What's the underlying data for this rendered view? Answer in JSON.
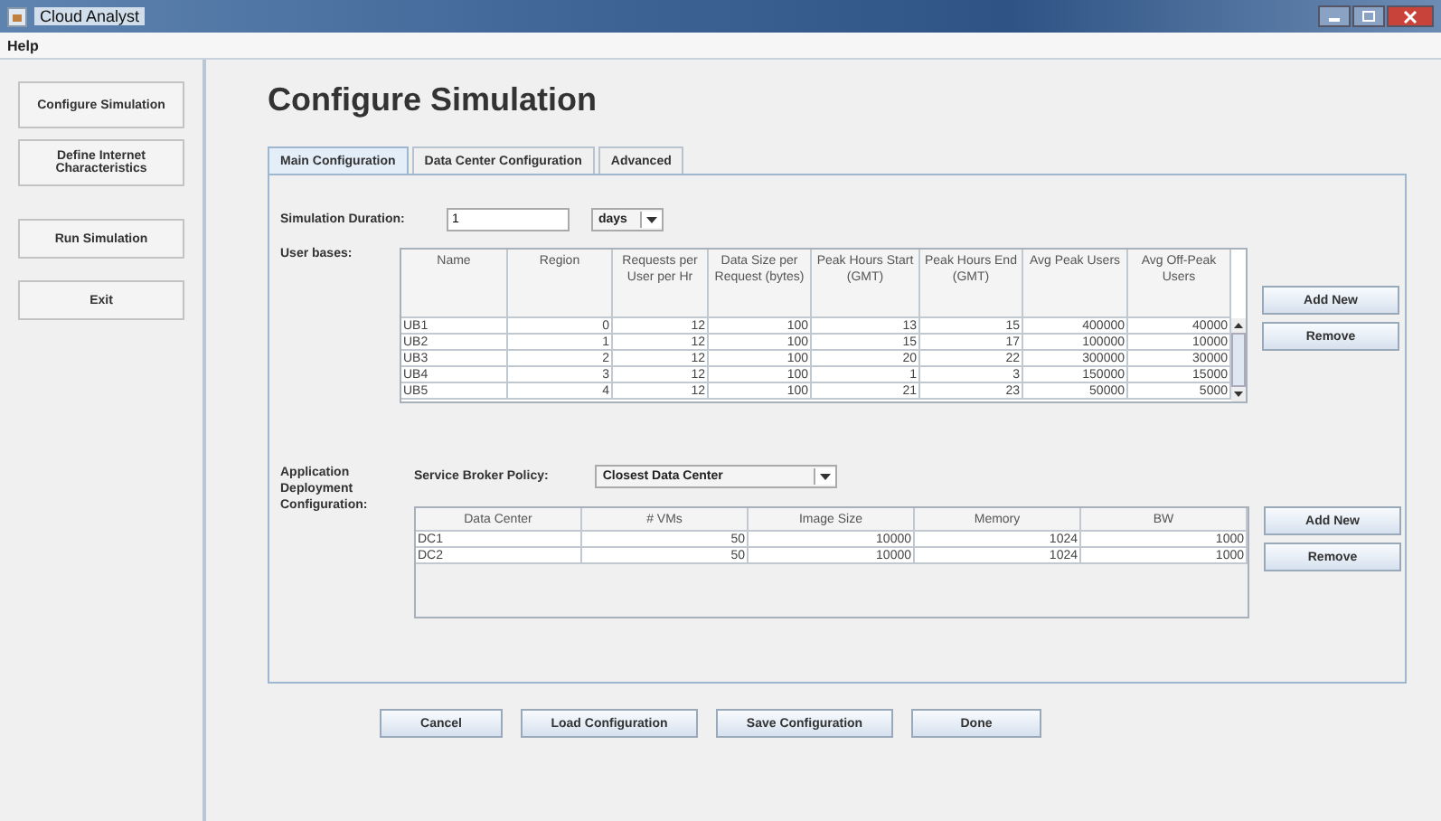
{
  "window": {
    "title": "Cloud Analyst"
  },
  "menu": [
    "Help"
  ],
  "sidebar": {
    "items": [
      {
        "label": "Configure Simulation"
      },
      {
        "label": "Define Internet Characteristics"
      },
      {
        "label": "Run Simulation"
      },
      {
        "label": "Exit"
      }
    ]
  },
  "page_title": "Configure Simulation",
  "tabs": [
    {
      "label": "Main Configuration",
      "selected": true
    },
    {
      "label": "Data Center Configuration",
      "selected": false
    },
    {
      "label": "Advanced",
      "selected": false
    }
  ],
  "duration": {
    "label": "Simulation Duration:",
    "value": "1",
    "unit": "days"
  },
  "user_bases": {
    "label": "User bases:",
    "columns": [
      "Name",
      "Region",
      "Requests per User per Hr",
      "Data Size per Request (bytes)",
      "Peak Hours Start (GMT)",
      "Peak Hours End (GMT)",
      "Avg Peak Users",
      "Avg Off-Peak Users"
    ],
    "rows": [
      [
        "UB1",
        "0",
        "12",
        "100",
        "13",
        "15",
        "400000",
        "40000"
      ],
      [
        "UB2",
        "1",
        "12",
        "100",
        "15",
        "17",
        "100000",
        "10000"
      ],
      [
        "UB3",
        "2",
        "12",
        "100",
        "20",
        "22",
        "300000",
        "30000"
      ],
      [
        "UB4",
        "3",
        "12",
        "100",
        "1",
        "3",
        "150000",
        "15000"
      ],
      [
        "UB5",
        "4",
        "12",
        "100",
        "21",
        "23",
        "50000",
        "5000"
      ]
    ],
    "buttons": [
      "Add New",
      "Remove"
    ]
  },
  "deployment": {
    "label": "Application Deployment Configuration:",
    "policy_label": "Service Broker Policy:",
    "policy_value": "Closest Data Center",
    "columns": [
      "Data Center",
      "# VMs",
      "Image Size",
      "Memory",
      "BW"
    ],
    "rows": [
      [
        "DC1",
        "50",
        "10000",
        "1024",
        "1000"
      ],
      [
        "DC2",
        "50",
        "10000",
        "1024",
        "1000"
      ]
    ],
    "buttons": [
      "Add New",
      "Remove"
    ]
  },
  "footer_buttons": [
    "Cancel",
    "Load Configuration",
    "Save Configuration",
    "Done"
  ]
}
